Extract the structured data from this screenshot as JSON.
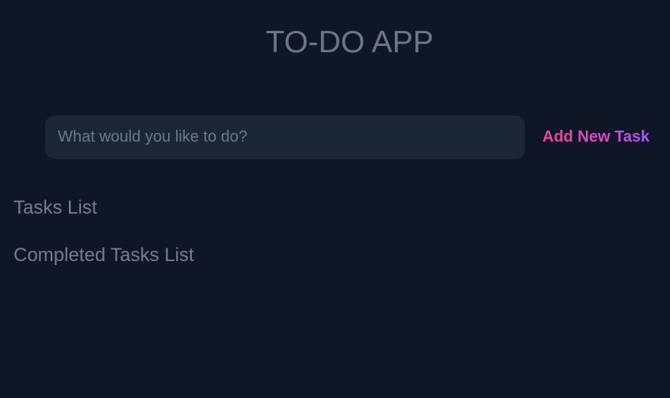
{
  "app": {
    "title": "TO-DO APP"
  },
  "new_task": {
    "input_value": "",
    "placeholder": "What would you like to do?",
    "add_button_label": "Add New Task"
  },
  "lists": {
    "tasks_heading": "Tasks List",
    "tasks": [],
    "completed_heading": "Completed Tasks List",
    "completed": []
  },
  "colors": {
    "background": "#0f1727",
    "input_background": "#1b2735",
    "text_muted": "#737f91",
    "accent_gradient_start": "#ec4899",
    "accent_gradient_end": "#a855f7"
  }
}
